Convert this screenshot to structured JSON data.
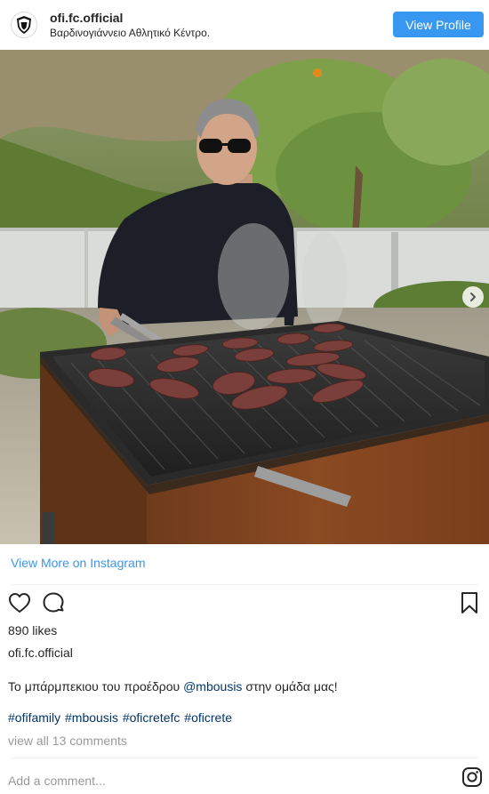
{
  "header": {
    "username": "ofi.fc.official",
    "location": "Βαρδινογιάννειο Αθλητικό Κέντρο.",
    "view_profile_label": "View Profile"
  },
  "photo": {
    "icon": "carousel-next-icon"
  },
  "links": {
    "view_more": "View More on Instagram"
  },
  "actions": {
    "like_icon": "heart-icon",
    "comment_icon": "comment-icon",
    "save_icon": "bookmark-icon"
  },
  "post": {
    "likes": "890 likes",
    "owner": "ofi.fc.official",
    "caption_before": "Το μπάρμπεκιου του προέδρου ",
    "caption_mention": "@mbousis",
    "caption_after": " στην ομάδα μας!",
    "hashtags": "#ofifamily #mbousis #oficretefc #oficrete",
    "comments_link": "view all 13 comments"
  },
  "comment_box": {
    "placeholder": "Add a comment..."
  },
  "colors": {
    "accent": "#3897f0",
    "link": "#003569",
    "muted": "#999999"
  }
}
